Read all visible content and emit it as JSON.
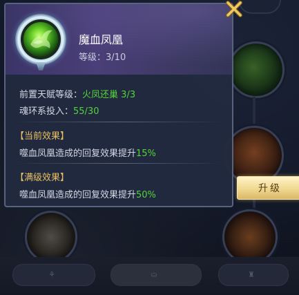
{
  "skill": {
    "name": "魔血凤凰",
    "level_label": "等级：",
    "level_value": "3/10"
  },
  "prerequisite": {
    "label": "前置天赋等级：",
    "talent_name": "火凤还巢",
    "talent_level": "3/3"
  },
  "investment": {
    "label": "魂环系投入：",
    "value": "55/30"
  },
  "current_effect": {
    "header": "【当前效果】",
    "text": "噬血凤凰造成的回复效果提升",
    "value": "15%"
  },
  "max_effect": {
    "header": "【满级效果】",
    "text": "噬血凤凰造成的回复效果提升",
    "value": "50%"
  },
  "upgrade_button": {
    "label": "升级"
  },
  "tabs": [
    {
      "label": "",
      "icon": "branch-icon"
    },
    {
      "label": "",
      "icon": "soul-ring-icon"
    },
    {
      "label": "",
      "icon": "tower-icon"
    }
  ],
  "colors": {
    "highlight_green": "#55d43a",
    "section_gold": "#e8c060",
    "close_gold": "#e8b850"
  }
}
